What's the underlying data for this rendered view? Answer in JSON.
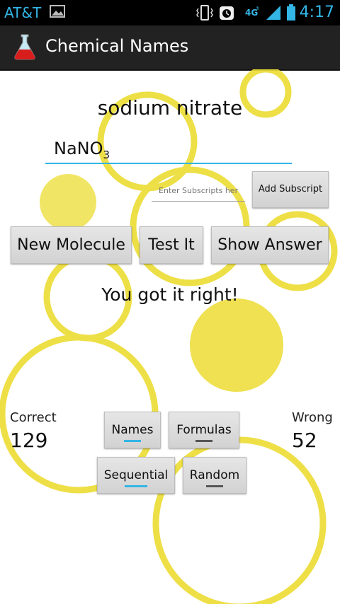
{
  "status_bar": {
    "carrier": "AT&T",
    "network": "4G",
    "time": "4:17"
  },
  "app": {
    "title": "Chemical Names"
  },
  "quiz": {
    "chemical_name": "sodium nitrate",
    "answer_main": "NaNO",
    "answer_subscript": "3",
    "subscript_placeholder": "Enter Subscripts her",
    "add_subscript_label": "Add Subscript",
    "feedback": "You got it right!"
  },
  "actions": {
    "new_molecule": "New Molecule",
    "test_it": "Test It",
    "show_answer": "Show Answer"
  },
  "score": {
    "correct_label": "Correct",
    "correct_value": "129",
    "wrong_label": "Wrong",
    "wrong_value": "52"
  },
  "modes": {
    "names": "Names",
    "formulas": "Formulas",
    "sequential": "Sequential",
    "random": "Random",
    "active_color": "#33b5e5",
    "inactive_color": "#555555"
  },
  "bubble_color": "#ecdc33"
}
